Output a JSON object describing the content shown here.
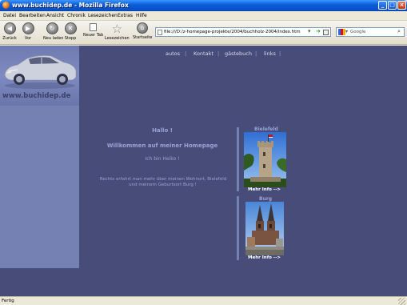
{
  "window": {
    "title": "www.buchidep.de - Mozilla Firefox"
  },
  "menu": [
    "Datei",
    "Bearbeiten",
    "Ansicht",
    "Chronik",
    "Lesezeichen",
    "Extras",
    "Hilfe"
  ],
  "toolbar": {
    "back_label": "Zurück",
    "forward_label": "Vor",
    "reload_label": "Neu laden",
    "stop_label": "Stopp",
    "newtab_label": "Neuer Tab",
    "bookmarks_label": "Lesezeichen",
    "home_label": "Startseite"
  },
  "address": {
    "url": "file:///D:/z-homepage-projekte/2004/buchholz-2004/index.htm"
  },
  "search": {
    "engine": "Google"
  },
  "page": {
    "logo_text": "www.buchidep.de",
    "nav": [
      "autos",
      "Kontakt",
      "gästebuch",
      "links"
    ],
    "greeting": "Hallo !",
    "welcome": "Willkommen auf meiner Homepage",
    "intro": "Ich bin Heiko !",
    "description_line1": "Rechts erfahrt man mehr über meinen Wohnort, Bielefeld",
    "description_line2": "und meinem Geburtsort Burg !",
    "places": [
      {
        "name": "Bielefeld",
        "link": "Mehr Info -->"
      },
      {
        "name": "Burg",
        "link": "Mehr Info -->"
      }
    ]
  },
  "status": {
    "text": "Fertig"
  },
  "colors": {
    "page_bg": "#474c78",
    "sidebar_bg": "#7581b3",
    "text": "#9aa3d8"
  }
}
